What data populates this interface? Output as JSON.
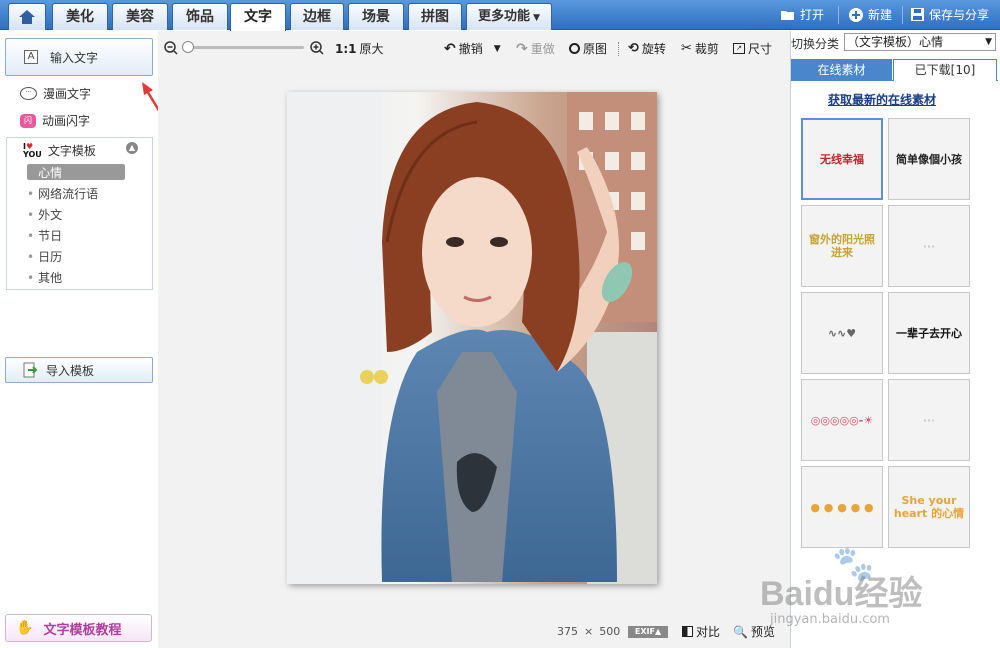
{
  "tabs": [
    "美化",
    "美容",
    "饰品",
    "文字",
    "边框",
    "场景",
    "拼图",
    "更多功能"
  ],
  "home_label": "",
  "header": {
    "open": "打开",
    "new": "新建",
    "save_share": "保存与分享"
  },
  "left": {
    "input_text": "输入文字",
    "comic_text": "漫画文字",
    "anim_text": "动画闪字",
    "template_title": "文字模板",
    "template_items": [
      "心情",
      "网络流行语",
      "外文",
      "节日",
      "日历",
      "其他"
    ],
    "import_template": "导入模板",
    "tutorial": "文字模板教程"
  },
  "toolbar": {
    "original_size": "原大",
    "ratio": "1:1",
    "undo": "撤销",
    "redo": "重做",
    "original": "原图",
    "rotate": "旋转",
    "crop": "裁剪",
    "size": "尺寸"
  },
  "status": {
    "width": "375",
    "x": "×",
    "height": "500",
    "exif": "EXIF▲",
    "compare": "对比",
    "preview": "预览"
  },
  "right": {
    "switch_label": "切换分类",
    "category": "（文字模板）心情",
    "tab_online": "在线素材",
    "tab_downloaded": "已下载[10]",
    "get_latest": "获取最新的在线素材",
    "thumbs": [
      {
        "text": "无线幸福",
        "color": "#c0282d"
      },
      {
        "text": "简单像個小孩",
        "color": "#222"
      },
      {
        "text": "窗外的阳光照进来",
        "color": "#c8a23a"
      },
      {
        "text": "···",
        "color": "#ccc"
      },
      {
        "text": "∿∿♥",
        "color": "#666"
      },
      {
        "text": "一辈子去开心",
        "color": "#111"
      },
      {
        "text": "◎◎◎◎◎-☀",
        "color": "#d2556a"
      },
      {
        "text": "···",
        "color": "#ccc"
      },
      {
        "text": "● ● ● ● ●",
        "color": "#e8a43b"
      },
      {
        "text": "She your heart 的心情",
        "color": "#e8a43b"
      }
    ]
  },
  "watermark": {
    "brand": "Baidu经验",
    "url": "jingyan.baidu.com"
  }
}
